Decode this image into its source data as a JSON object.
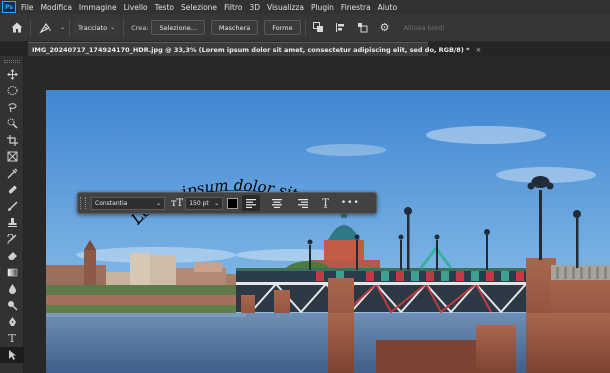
{
  "app": {
    "logo": "Ps"
  },
  "menu": [
    "File",
    "Modifica",
    "Immagine",
    "Livello",
    "Testo",
    "Selezione",
    "Filtro",
    "3D",
    "Visualizza",
    "Plugin",
    "Finestra",
    "Aiuto"
  ],
  "options": {
    "mode_label": "Tracciato",
    "make_label": "Crea:",
    "selection_button": "Selezione...",
    "mask_button": "Maschera",
    "shape_button": "Forme",
    "align_edges": "Allinea bordi",
    "icons": [
      "home-icon",
      "pen-tool-icon",
      "path-operations-icon",
      "path-alignment-icon",
      "path-arrangement-icon",
      "gear-icon"
    ]
  },
  "document": {
    "tab_title": "IMG_20240717_174924170_HDR.jpg @ 33,3% (Lorem ipsum dolor sit amet, consectetur adipiscing elit, sed do, RGB/8) *",
    "close_glyph": "×"
  },
  "photo": {
    "path_text": "Lorem ipsum dolor sit"
  },
  "text_toolbar": {
    "font": "Constantia",
    "size": "150 pt",
    "text_color": "#000000",
    "align_active": "left",
    "warp_icon": "warp-text-icon",
    "more": "•••"
  },
  "tools": [
    "move",
    "marquee",
    "lasso",
    "quick-selection",
    "crop",
    "frame",
    "eyedropper",
    "healing-brush",
    "brush",
    "clone-stamp",
    "history-brush",
    "eraser",
    "gradient",
    "blur",
    "dodge",
    "pen",
    "type",
    "path-selection"
  ],
  "colors": {
    "accent": "#31a8ff",
    "ui_bg": "#323232",
    "sky": "#5f9fd8",
    "brick": "#9b5a44",
    "water": "#5b7da6"
  }
}
